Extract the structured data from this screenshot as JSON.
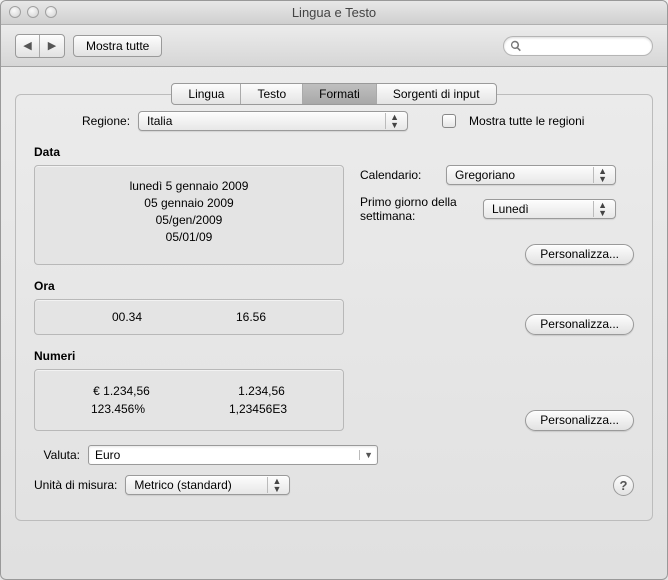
{
  "window": {
    "title": "Lingua e Testo"
  },
  "toolbar": {
    "show_all": "Mostra tutte",
    "search_placeholder": ""
  },
  "tabs": {
    "lingua": "Lingua",
    "testo": "Testo",
    "formati": "Formati",
    "sorgenti": "Sorgenti di input"
  },
  "region": {
    "label": "Regione:",
    "value": "Italia",
    "show_all_checkbox": "Mostra tutte le regioni"
  },
  "sections": {
    "data": {
      "title": "Data",
      "samples": [
        "lunedì 5 gennaio 2009",
        "05 gennaio 2009",
        "05/gen/2009",
        "05/01/09"
      ],
      "calendar_label": "Calendario:",
      "calendar_value": "Gregoriano",
      "first_day_label": "Primo giorno della settimana:",
      "first_day_value": "Lunedì",
      "customize": "Personalizza..."
    },
    "ora": {
      "title": "Ora",
      "samples": [
        "00.34",
        "16.56"
      ],
      "customize": "Personalizza..."
    },
    "numeri": {
      "title": "Numeri",
      "row1": [
        "€ 1.234,56",
        "1.234,56"
      ],
      "row2": [
        "123.456%",
        "1,23456E3"
      ],
      "customize": "Personalizza..."
    }
  },
  "currency": {
    "label": "Valuta:",
    "value": "Euro"
  },
  "units": {
    "label": "Unità di misura:",
    "value": "Metrico (standard)"
  },
  "help": "?"
}
